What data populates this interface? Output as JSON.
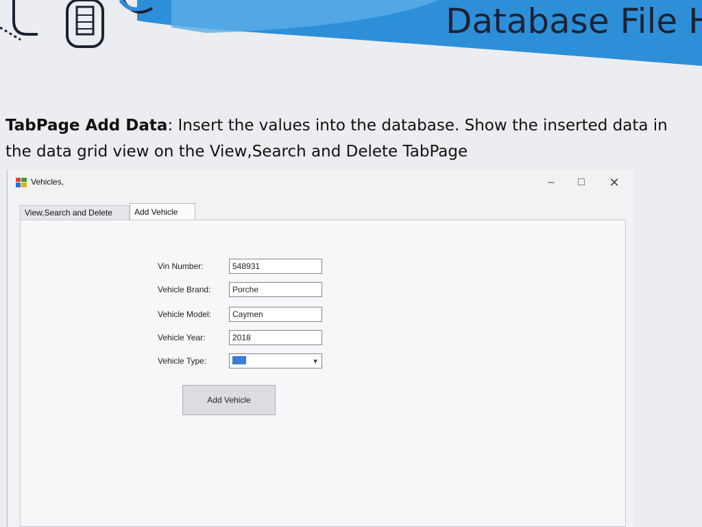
{
  "banner": {
    "title": "Database File Ha",
    "colors": {
      "accent": "#2d8fd8",
      "light": "#9fd0f2"
    }
  },
  "document": {
    "heading": "TabPage Add Data",
    "text": ": Insert the values into the database. Show the inserted data in the data grid view on the View,Search and Delete TabPage"
  },
  "window": {
    "title": "Vehicles,",
    "minimize": "–",
    "maximize": "□",
    "close": "✕",
    "tabs": [
      {
        "label": "View,Search and Delete",
        "active": false
      },
      {
        "label": "Add Vehicle",
        "active": true
      }
    ]
  },
  "form": {
    "vin_label": "Vin Number:",
    "vin_value": "548931",
    "brand_label": "Vehicle Brand:",
    "brand_value": "Porche",
    "model_label": "Vehicle Model:",
    "model_value": "Caymen",
    "year_label": "Vehicle Year:",
    "year_value": "2018",
    "type_label": "Vehicle Type:",
    "add_button": "Add Vehicle"
  }
}
